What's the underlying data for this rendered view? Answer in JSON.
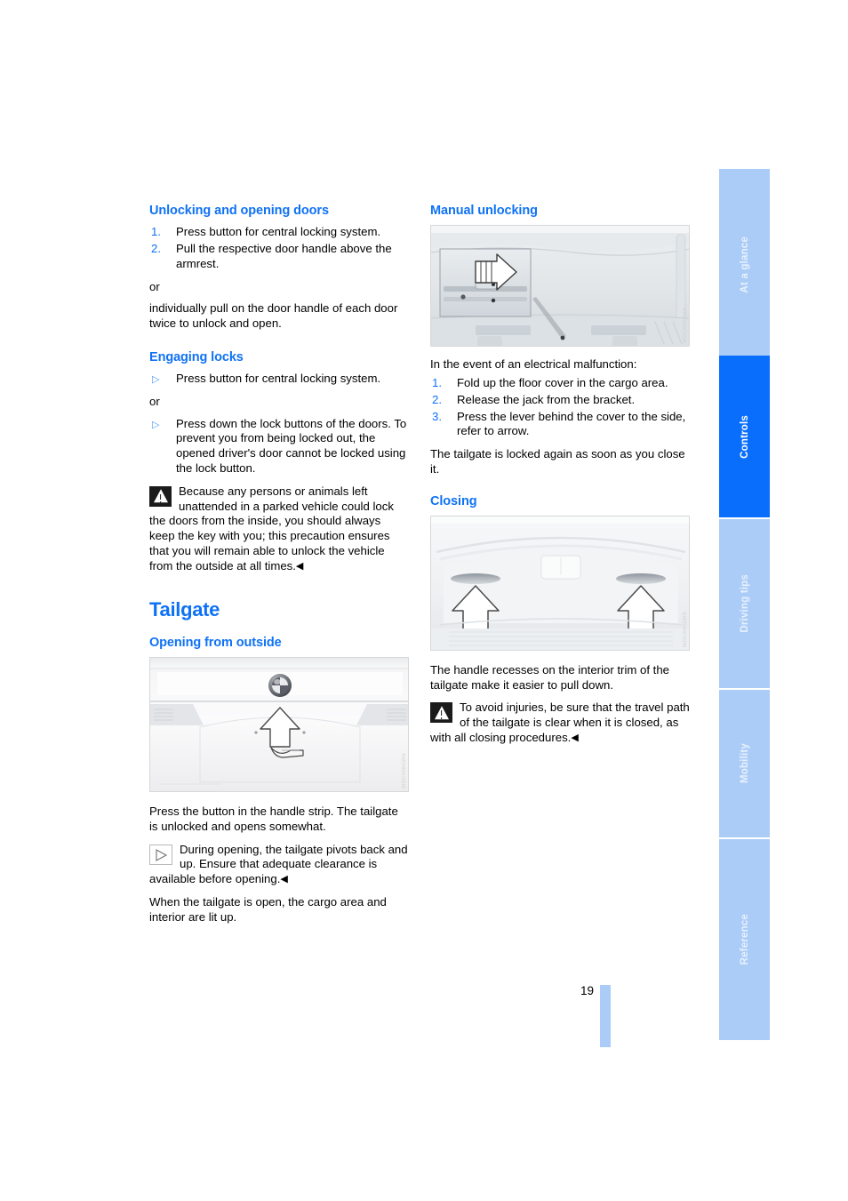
{
  "page": {
    "number": "19",
    "heading_color": "#0f72f5",
    "tab_active_color": "#0a6efd",
    "tab_inactive_color": "#aaccf7"
  },
  "left_column": {
    "section_unlocking": {
      "heading": "Unlocking and opening doors",
      "steps": [
        {
          "num": "1.",
          "text": "Press button for central locking system."
        },
        {
          "num": "2.",
          "text": "Pull the respective door handle above the armrest."
        }
      ],
      "or": "or",
      "after_or": "individually pull on the door handle of each door twice to unlock and open."
    },
    "section_engaging": {
      "heading": "Engaging locks",
      "bullets_first": [
        {
          "marker": "▷",
          "text": "Press button for central locking system."
        }
      ],
      "or": "or",
      "bullets_second": [
        {
          "marker": "▷",
          "text": "Press down the lock buttons of the doors. To prevent you from being locked out, the opened driver's door cannot be locked using the lock button."
        }
      ],
      "warning": {
        "icon": "warning-triangle-icon",
        "text": "Because any persons or animals left unattended in a parked vehicle could lock the doors from the inside, you should always keep the key with you; this precaution ensures that you will remain able to unlock the vehicle from the outside at all times.",
        "endmark": "◀"
      }
    },
    "chapter_title": "Tailgate",
    "section_opening_outside": {
      "heading": "Opening from outside",
      "figure": {
        "name": "tailgate-exterior-photo",
        "code": "WDCXHIGWN",
        "alt_elements": [
          "bmw-roundel-badge",
          "up-arrow",
          "handle-strip-button"
        ]
      },
      "paragraph_1": "Press the button in the handle strip. The tailgate is unlocked and opens somewhat.",
      "note": {
        "icon": "note-triangle-icon",
        "text": "During opening, the tailgate pivots back and up. Ensure that adequate clearance is available before opening.",
        "endmark": "◀"
      },
      "paragraph_2": "When the tailgate is open, the cargo area and interior are lit up."
    }
  },
  "right_column": {
    "section_manual_unlocking": {
      "heading": "Manual unlocking",
      "figure": {
        "name": "manual-unlocking-photo",
        "code": "WDCXHIGWN",
        "alt_elements": [
          "inset-detail-box",
          "right-arrow",
          "callout-line",
          "lever"
        ]
      },
      "intro": "In the event of an electrical malfunction:",
      "steps": [
        {
          "num": "1.",
          "text": "Fold up the floor cover in the cargo area."
        },
        {
          "num": "2.",
          "text": "Release the jack from the bracket."
        },
        {
          "num": "3.",
          "text": "Press the lever behind the cover to the side, refer to arrow."
        }
      ],
      "closing_note": "The tailgate is locked again as soon as you close it."
    },
    "section_closing": {
      "heading": "Closing",
      "figure": {
        "name": "tailgate-interior-trim-photo",
        "code": "WDCXHIGWN",
        "alt_elements": [
          "left-handle-recess",
          "right-handle-recess",
          "up-arrow-left",
          "up-arrow-right"
        ]
      },
      "paragraph_1": "The handle recesses on the interior trim of the tailgate make it easier to pull down.",
      "warning": {
        "icon": "warning-triangle-icon",
        "text": "To avoid injuries, be sure that the travel path of the tailgate is clear when it is closed, as with all closing procedures.",
        "endmark": "◀"
      }
    }
  },
  "tab_rail": {
    "tabs": [
      {
        "label": "At a glance",
        "active": false
      },
      {
        "label": "Controls",
        "active": true
      },
      {
        "label": "Driving tips",
        "active": false
      },
      {
        "label": "Mobility",
        "active": false
      },
      {
        "label": "Reference",
        "active": false
      }
    ]
  }
}
